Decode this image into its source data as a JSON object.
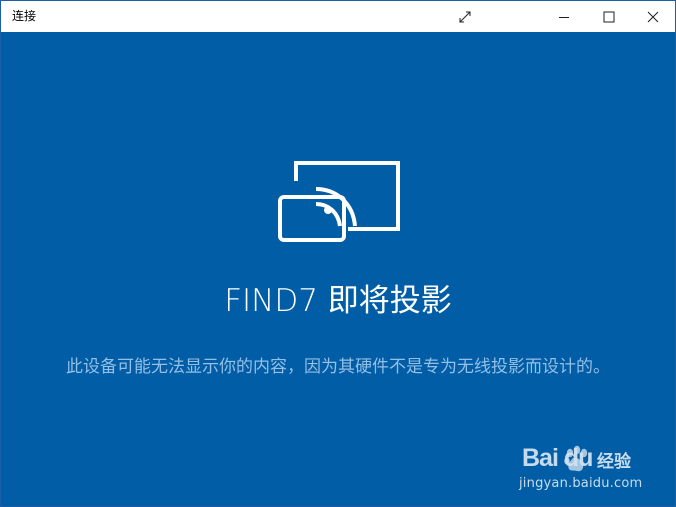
{
  "window": {
    "title": "连接"
  },
  "titlebar_buttons": [
    {
      "name": "expand",
      "icon": "expand-icon"
    },
    {
      "name": "minimize",
      "icon": "minimize-icon"
    },
    {
      "name": "maximize",
      "icon": "maximize-icon"
    },
    {
      "name": "close",
      "icon": "close-icon"
    }
  ],
  "main": {
    "icon": "project-to-screen-icon",
    "heading": "FIND7 即将投影",
    "message": "此设备可能无法显示你的内容，因为其硬件不是专为无线投影而设计的。"
  },
  "watermark": {
    "brand": "Bai du",
    "label": "经验",
    "url": "jingyan.baidu.com"
  },
  "colors": {
    "background": "#005da6",
    "message": "#94bfe6",
    "heading": "#ffffff"
  }
}
